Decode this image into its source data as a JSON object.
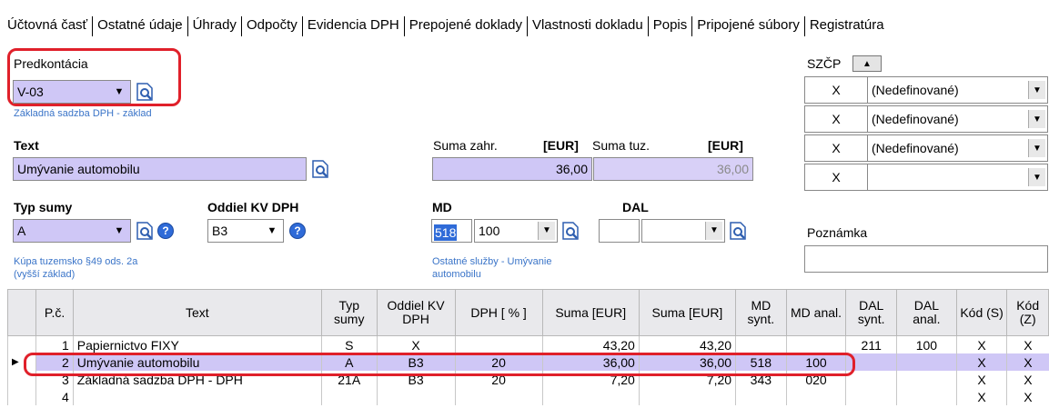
{
  "tabs": [
    "Účtovná časť",
    "Ostatné údaje",
    "Úhrady",
    "Odpočty",
    "Evidencia DPH",
    "Prepojené doklady",
    "Vlastnosti dokladu",
    "Popis",
    "Pripojené súbory",
    "Registratúra"
  ],
  "predkontacia": {
    "label": "Predkontácia",
    "value": "V-03",
    "hint": "Základná sadzba DPH - základ"
  },
  "text": {
    "label": "Text",
    "value": "Umývanie automobilu"
  },
  "suma_zahr": {
    "label": "Suma zahr.",
    "currency": "[EUR]",
    "value": "36,00"
  },
  "suma_tuz": {
    "label": "Suma tuz.",
    "currency": "[EUR]",
    "value": "36,00"
  },
  "typ_sumy": {
    "label": "Typ sumy",
    "value": "A",
    "hint1": "Kúpa tuzemsko §49 ods. 2a",
    "hint2": "(vyšší základ)"
  },
  "oddiel": {
    "label": "Oddiel KV DPH",
    "value": "B3"
  },
  "md": {
    "label": "MD",
    "synt": "518",
    "anal": "100",
    "hint1": "Ostatné služby - Umývanie",
    "hint2": "automobilu"
  },
  "dal": {
    "label": "DAL",
    "synt": "",
    "anal": ""
  },
  "szcp": {
    "label": "SZČP",
    "rows": [
      {
        "x": "X",
        "value": "(Nedefinované)"
      },
      {
        "x": "X",
        "value": "(Nedefinované)"
      },
      {
        "x": "X",
        "value": "(Nedefinované)"
      },
      {
        "x": "X",
        "value": ""
      }
    ]
  },
  "poznamka": {
    "label": "Poznámka",
    "value": ""
  },
  "grid": {
    "headers": [
      "P.č.",
      "Text",
      "Typ sumy",
      "Oddiel KV DPH",
      "DPH [ % ]",
      "Suma [EUR]",
      "Suma [EUR]",
      "MD synt.",
      "MD anal.",
      "DAL synt.",
      "DAL anal.",
      "Kód (S)",
      "Kód (Z)"
    ],
    "rows": [
      [
        "1",
        "Papiernictvo FIXY",
        "S",
        "X",
        "",
        "43,20",
        "43,20",
        "",
        "",
        "211",
        "100",
        "X",
        "X"
      ],
      [
        "2",
        "Umývanie automobilu",
        "A",
        "B3",
        "20",
        "36,00",
        "36,00",
        "518",
        "100",
        "",
        "",
        "X",
        "X"
      ],
      [
        "3",
        "Základná sadzba DPH - DPH",
        "21A",
        "B3",
        "20",
        "7,20",
        "7,20",
        "343",
        "020",
        "",
        "",
        "X",
        "X"
      ],
      [
        "4",
        "",
        "",
        "",
        "",
        "",
        "",
        "",
        "",
        "",
        "",
        "X",
        "X"
      ]
    ]
  }
}
